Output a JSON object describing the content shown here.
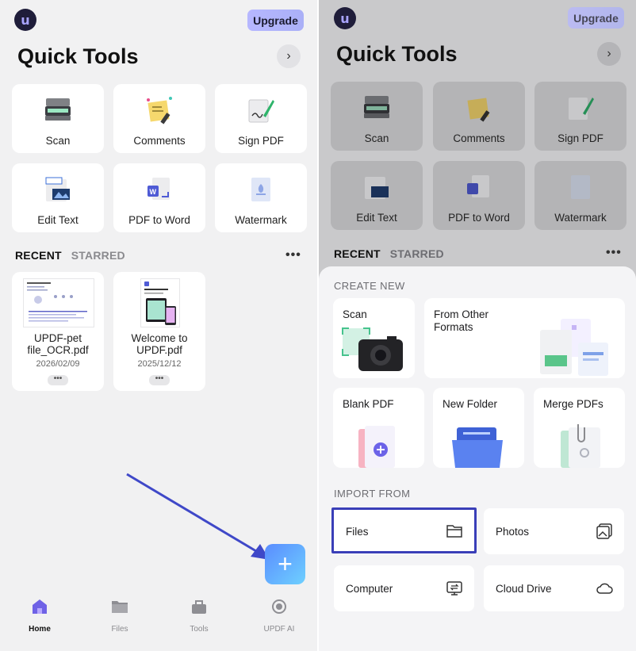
{
  "header": {
    "logo_letter": "u",
    "upgrade_label": "Upgrade",
    "title": "Quick Tools"
  },
  "tools": [
    {
      "label": "Scan",
      "icon": "scanner-icon"
    },
    {
      "label": "Comments",
      "icon": "sticky-note-icon"
    },
    {
      "label": "Sign PDF",
      "icon": "signature-pen-icon"
    },
    {
      "label": "Edit Text",
      "icon": "edit-text-icon"
    },
    {
      "label": "PDF to Word",
      "icon": "word-convert-icon"
    },
    {
      "label": "Watermark",
      "icon": "watermark-icon"
    }
  ],
  "tabs": {
    "recent": "RECENT",
    "starred": "STARRED",
    "more": "•••"
  },
  "files": [
    {
      "name": "UPDF-pet file_OCR.pdf",
      "date": "2026/02/09",
      "more": "•••"
    },
    {
      "name": "Welcome to UPDF.pdf",
      "date": "2025/12/12",
      "more": "•••"
    }
  ],
  "fab_label": "+",
  "nav": [
    {
      "label": "Home",
      "icon": "home-icon",
      "active": true
    },
    {
      "label": "Files",
      "icon": "folder-icon",
      "active": false
    },
    {
      "label": "Tools",
      "icon": "toolbox-icon",
      "active": false
    },
    {
      "label": "UPDF AI",
      "icon": "ai-icon",
      "active": false
    }
  ],
  "sheet": {
    "create_title": "CREATE NEW",
    "create_items": [
      {
        "label": "Scan"
      },
      {
        "label": "From Other Formats"
      },
      {
        "label": "Blank PDF"
      },
      {
        "label": "New Folder"
      },
      {
        "label": "Merge PDFs"
      }
    ],
    "import_title": "IMPORT FROM",
    "import_items": [
      {
        "label": "Files",
        "icon": "folder-icon"
      },
      {
        "label": "Photos",
        "icon": "photos-icon"
      },
      {
        "label": "Computer",
        "icon": "computer-transfer-icon"
      },
      {
        "label": "Cloud Drive",
        "icon": "cloud-icon"
      }
    ]
  },
  "colors": {
    "accent": "#5a8cff",
    "highlight": "#3a3fb8",
    "arrow": "#3f48c8"
  }
}
